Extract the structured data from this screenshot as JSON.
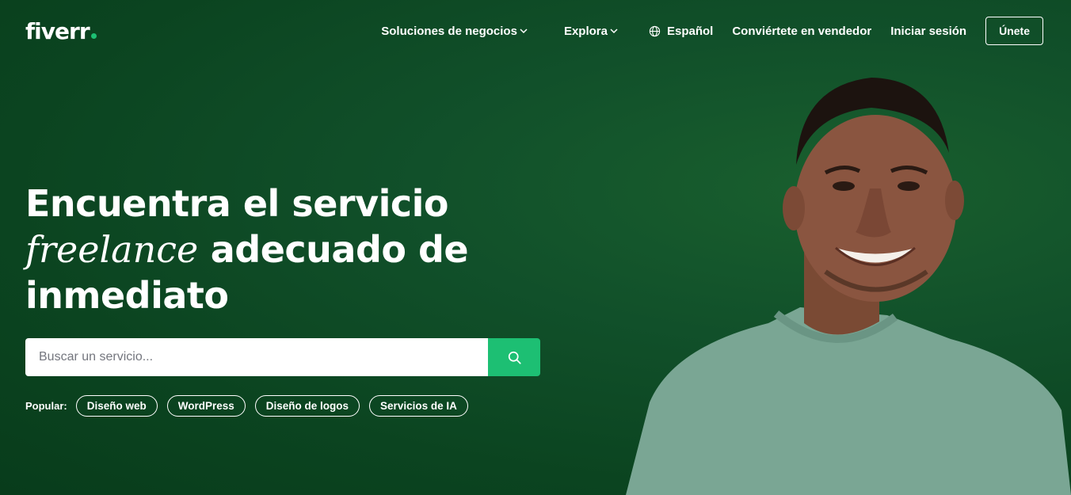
{
  "header": {
    "logo": "fiverr",
    "nav": {
      "business_solutions": "Soluciones de negocios",
      "explore": "Explora",
      "language": "Español",
      "become_seller": "Conviértete en vendedor",
      "sign_in": "Iniciar sesión",
      "join": "Únete"
    }
  },
  "hero": {
    "headline_line1": "Encuentra el servicio",
    "headline_italic": "freelance",
    "headline_line2_rest": " adecuado de",
    "headline_line3": "inmediato"
  },
  "search": {
    "placeholder": "Buscar un servicio..."
  },
  "popular": {
    "label": "Popular:",
    "tags": [
      "Diseño web",
      "WordPress",
      "Diseño de logos",
      "Servicios de IA"
    ]
  },
  "colors": {
    "background": "#0d4a22",
    "accent": "#1dbf73",
    "text": "#ffffff"
  },
  "icons": {
    "search": "search-icon",
    "globe": "globe-icon",
    "chevron": "chevron-down-icon"
  }
}
